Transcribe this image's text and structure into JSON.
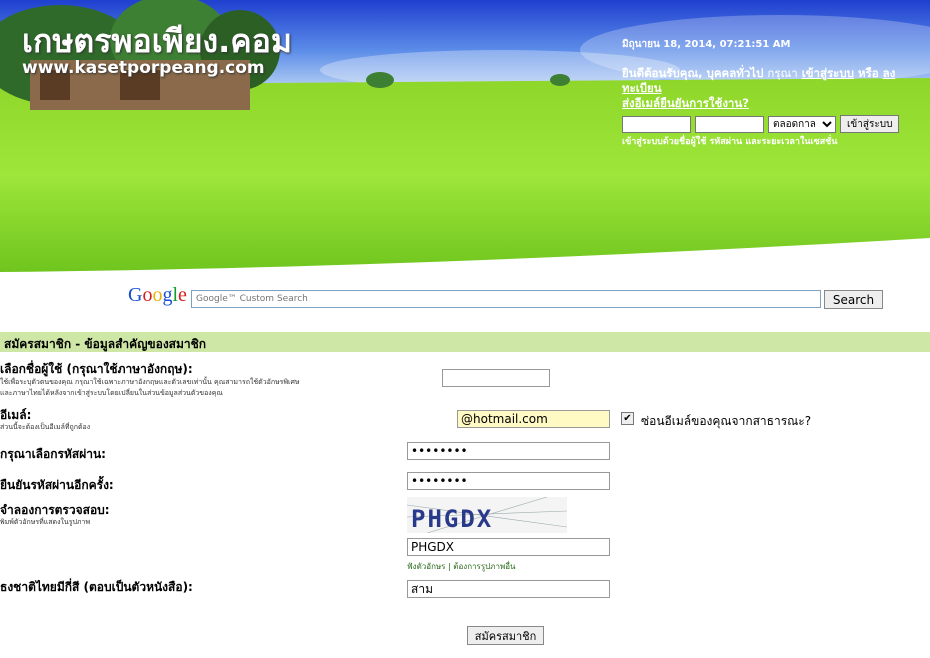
{
  "header": {
    "site_title": "เกษตรพอเพียง.คอม",
    "site_url": "www.kasetporpeang.com",
    "datetime": "มิถุนายน 18, 2014, 07:21:51 AM",
    "welcome_prefix": "ยินดีต้อนรับคุณ,",
    "guest_name": "บุคคลทั่วไป",
    "please": "กรุณา",
    "login_link": "เข้าสู่ระบบ",
    "or": "หรือ",
    "register_link": "ลงทะเบียน",
    "resend_link": "ส่งอีเมล์ยืนยันการใช้งาน?",
    "login_duration": "ตลอดกาล",
    "login_button": "เข้าสู่ระบบ",
    "login_note": "เข้าสู่ระบบด้วยชื่อผู้ใช้ รหัสผ่าน และระยะเวลาในเซสชั่น"
  },
  "search": {
    "logo": [
      "G",
      "o",
      "o",
      "g",
      "l",
      "e"
    ],
    "placeholder": "Google™ Custom Search",
    "button": "Search"
  },
  "register": {
    "section_title": "สมัครสมาชิก - ข้อมูลสำคัญของสมาชิก",
    "username_label": "เลือกชื่อผู้ใช้ (กรุณาใช้ภาษาอังกฤษ):",
    "username_hint_1": "ใช้เพื่อระบุตัวตนของคุณ กรุณาใช้เฉพาะภาษาอังกฤษและตัวเลขเท่านั้น คุณสามารถใช้ตัวอักษรพิเศษ",
    "username_hint_2": "และภาษาไทยได้หลังจากเข้าสู่ระบบโดยเปลี่ยนในส่วนข้อมูลส่วนตัวของคุณ",
    "username_value": "",
    "email_label": "อีเมล์:",
    "email_hint": "ส่วนนี้จะต้องเป็นอีเมล์ที่ถูกต้อง",
    "email_value": "@hotmail.com",
    "hide_email_label": "ซ่อนอีเมล์ของคุณจากสาธารณะ?",
    "hide_email_check": "✔",
    "password_label": "กรุณาเลือกรหัสผ่าน:",
    "password_value": "••••••••",
    "confirm_label": "ยืนยันรหัสผ่านอีกครั้ง:",
    "confirm_value": "••••••••",
    "captcha_label": "จำลองการตรวจสอบ:",
    "captcha_hint": "พิมพ์ตัวอักษรที่แสดงในรูปภาพ",
    "captcha_text": "PHGDX",
    "captcha_value": "PHGDX",
    "captcha_listen": "ฟังตัวอักษร",
    "captcha_sep": "|",
    "captcha_other": "ต้องการรูปภาพอื่น",
    "flag_label": "ธงชาติไทยมีกี่สี (ตอบเป็นตัวหนังสือ):",
    "flag_value": "สาม",
    "submit": "สมัครสมาชิก"
  },
  "colors": {
    "section_bar": "#cfe7a6",
    "sky_top": "#1c4fd6",
    "grass": "#8ee02a"
  }
}
